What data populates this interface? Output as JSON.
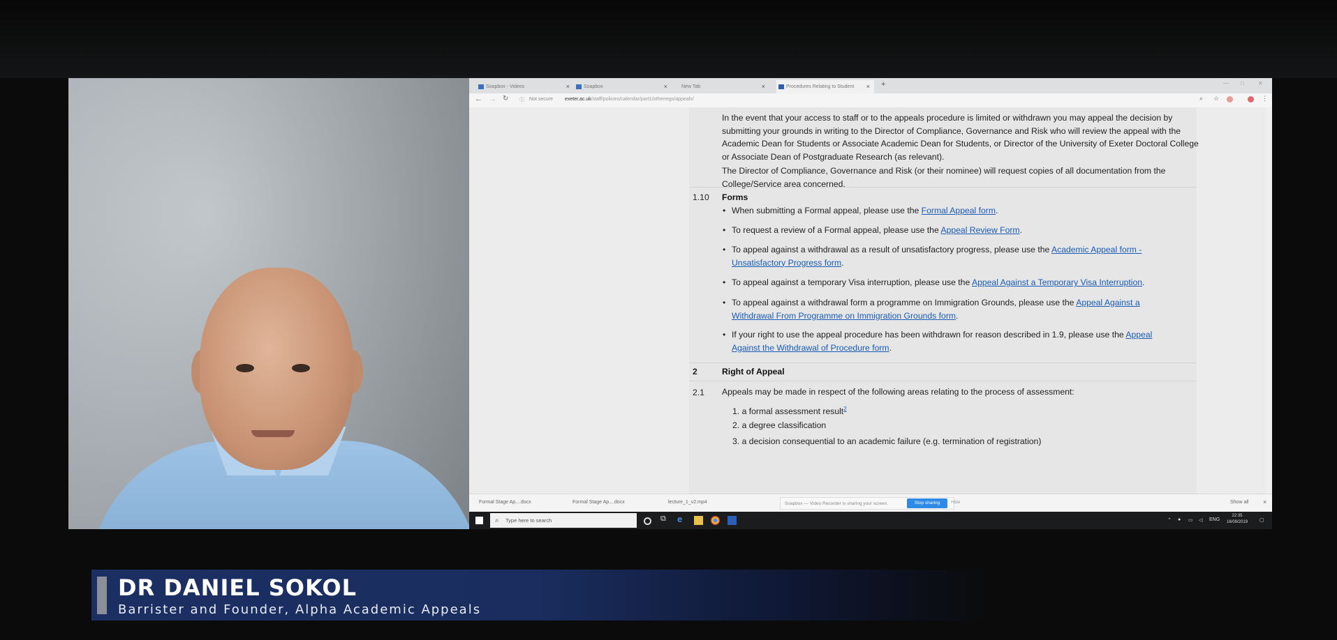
{
  "browser": {
    "tabs": [
      {
        "label": "Soapbox - Videos"
      },
      {
        "label": "Soapbox"
      },
      {
        "label": "New Tab"
      },
      {
        "label": "Procedures Relating to Student"
      }
    ],
    "new_tab": "+",
    "tab_close": "×",
    "url_lock": "ⓘ",
    "url_not_secure": "Not secure",
    "url_host": "exeter.ac.uk",
    "url_path": "/staff/policies/calendar/part1/otherregs/appeals/"
  },
  "document": {
    "para1": "In the event that your access to staff or to the appeals procedure is limited or withdrawn you may appeal the decision by submitting your grounds in writing to the Director of Compliance, Governance and Risk who will review the appeal with the Academic Dean for Students or Associate Academic Dean for Students, or Director of the University of Exeter Doctoral College or Associate Dean of Postgraduate Research (as relevant).",
    "para2": "The Director of Compliance, Governance and Risk (or their nominee) will request copies of all documentation from the College/Service area concerned.",
    "s110_num": "1.10",
    "s110_title": "Forms",
    "bullet_char": "•",
    "bullets": [
      {
        "pre": "When submitting a Formal appeal, please use the ",
        "link": "Formal Appeal form",
        "post": "."
      },
      {
        "pre": "To request a review of a Formal appeal, please use the ",
        "link": "Appeal Review Form",
        "post": "."
      },
      {
        "pre": "To appeal against a withdrawal as a result of unsatisfactory progress, please use the ",
        "link": "Academic Appeal form - Unsatisfactory Progress form",
        "post": "."
      },
      {
        "pre": "To appeal against a temporary Visa interruption, please use the ",
        "link": "Appeal Against a Temporary Visa Interruption",
        "post": "."
      },
      {
        "pre": "To appeal against a withdrawal form a programme on Immigration Grounds, please use the ",
        "link": "Appeal Against a Withdrawal From Programme on Immigration Grounds form",
        "post": "."
      },
      {
        "pre": "If your right to use the appeal procedure has been withdrawn for reason described in 1.9, please use the ",
        "link": "Appeal Against the Withdrawal of Procedure form",
        "post": "."
      }
    ],
    "s2_num": "2",
    "s2_title": "Right of Appeal",
    "s21_num": "2.1",
    "s21_text": "Appeals may be made in respect of the following areas relating to the process of assessment:",
    "list": [
      {
        "n": "1.",
        "text": "a formal assessment result",
        "sup": "2"
      },
      {
        "n": "2.",
        "text": "a degree classification",
        "sup": ""
      },
      {
        "n": "3.",
        "text": "a decision consequential to an academic failure (e.g. termination of registration)",
        "sup": ""
      }
    ]
  },
  "downloads": {
    "items": [
      {
        "label": "Formal Stage Ap....docx"
      },
      {
        "label": "Formal Stage Ap....docx"
      },
      {
        "label": "lecture_1_v2.mp4"
      }
    ],
    "share_text": "Soapbox — Video Recorder is sharing your screen.",
    "stop_sharing": "Stop sharing",
    "hide": "Hide",
    "show_all": "Show all",
    "close": "×"
  },
  "taskbar": {
    "search_placeholder": "Type here to search",
    "language": "ENG",
    "time": "22:35",
    "date": "16/09/2019"
  },
  "lower_third": {
    "name": "DR DANIEL SOKOL",
    "title": "Barrister and Founder, Alpha Academic Appeals"
  },
  "colors": {
    "link": "#1a5bb5",
    "lower_third_bg": "#1c2f63",
    "stop_sharing_bg": "#2d8ae6"
  }
}
